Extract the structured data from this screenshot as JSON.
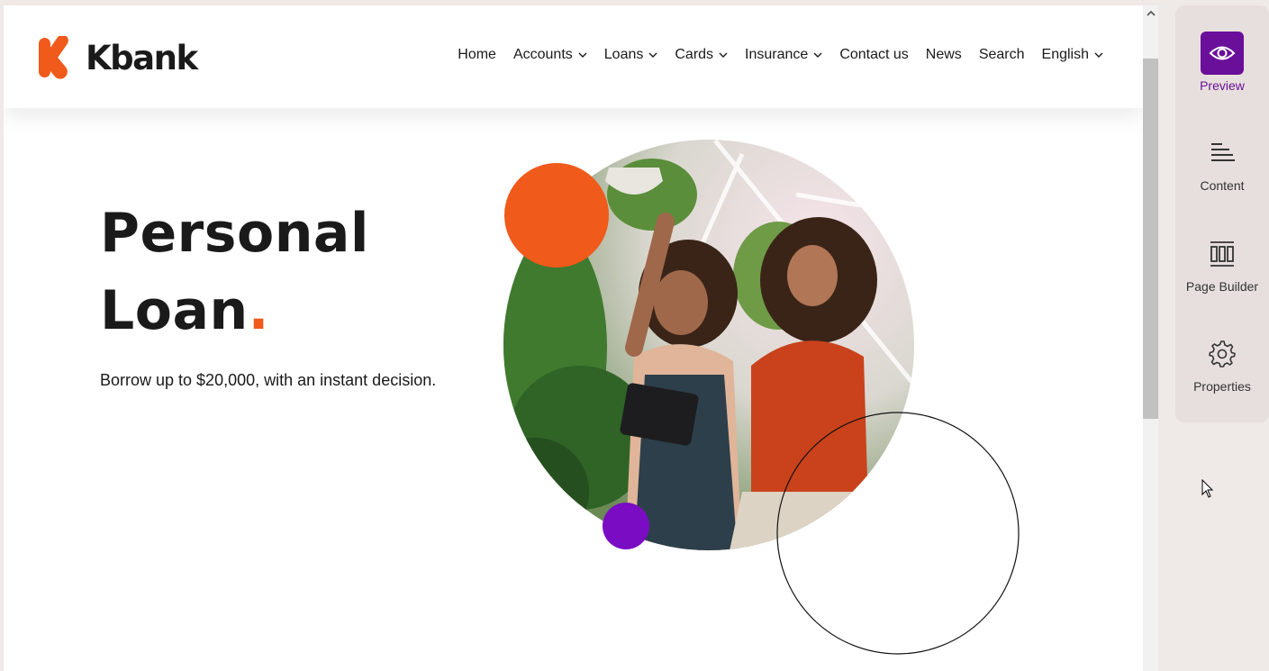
{
  "brand": {
    "name": "Kbank",
    "logo_color": "#f05a1a"
  },
  "nav": {
    "items": [
      {
        "label": "Home",
        "dropdown": false
      },
      {
        "label": "Accounts",
        "dropdown": true
      },
      {
        "label": "Loans",
        "dropdown": true
      },
      {
        "label": "Cards",
        "dropdown": true
      },
      {
        "label": "Insurance",
        "dropdown": true
      },
      {
        "label": "Contact us",
        "dropdown": false
      },
      {
        "label": "News",
        "dropdown": false
      },
      {
        "label": "Search",
        "dropdown": false
      },
      {
        "label": "English",
        "dropdown": true
      }
    ]
  },
  "hero": {
    "title_line1": "Personal",
    "title_line2": "Loan",
    "title_dot": ".",
    "subtitle": "Borrow up to $20,000, with an instant decision."
  },
  "panel": {
    "tools": [
      {
        "label": "Preview",
        "icon": "eye-icon",
        "active": true
      },
      {
        "label": "Content",
        "icon": "content-lines-icon",
        "active": false
      },
      {
        "label": "Page Builder",
        "icon": "page-builder-icon",
        "active": false
      },
      {
        "label": "Properties",
        "icon": "gear-icon",
        "active": false
      }
    ]
  },
  "colors": {
    "accent_orange": "#f05a1a",
    "accent_purple": "#7a0cc4",
    "panel_active": "#6a0f9a",
    "text": "#1a1a1a"
  }
}
